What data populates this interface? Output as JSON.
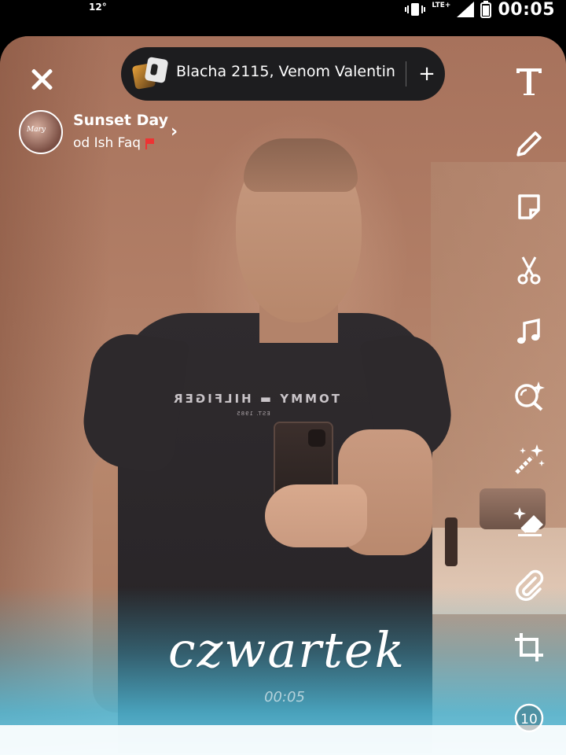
{
  "status_bar": {
    "temperature": "12°",
    "network": "LTE+",
    "time": "00:05"
  },
  "sound": {
    "title": "Blacha 2115, Venom Valentin",
    "add_label": "+"
  },
  "story": {
    "title": "Sunset Day",
    "subtitle": "od Ish Faq",
    "avatar_text": "Mary"
  },
  "photo": {
    "tee_brand": "TOMMY ▬ HILFIGER",
    "tee_sub": "EST. 1985"
  },
  "toolbar": {
    "items": [
      {
        "name": "text-tool-icon",
        "icon": "T"
      },
      {
        "name": "pencil-tool-icon",
        "icon": "pencil"
      },
      {
        "name": "sticker-tool-icon",
        "icon": "sticker"
      },
      {
        "name": "scissors-tool-icon",
        "icon": "scissors"
      },
      {
        "name": "music-tool-icon",
        "icon": "music-note"
      },
      {
        "name": "lens-tool-icon",
        "icon": "magnify-sparkle"
      },
      {
        "name": "magic-wand-tool-icon",
        "icon": "magic-wand"
      },
      {
        "name": "eraser-tool-icon",
        "icon": "eraser-sparkle"
      },
      {
        "name": "attachment-tool-icon",
        "icon": "paperclip"
      },
      {
        "name": "crop-tool-icon",
        "icon": "crop"
      },
      {
        "name": "timer-tool-icon",
        "icon": "timer"
      }
    ],
    "timer_value": "10"
  },
  "sticker": {
    "day": "czwartek",
    "time": "00:05"
  }
}
